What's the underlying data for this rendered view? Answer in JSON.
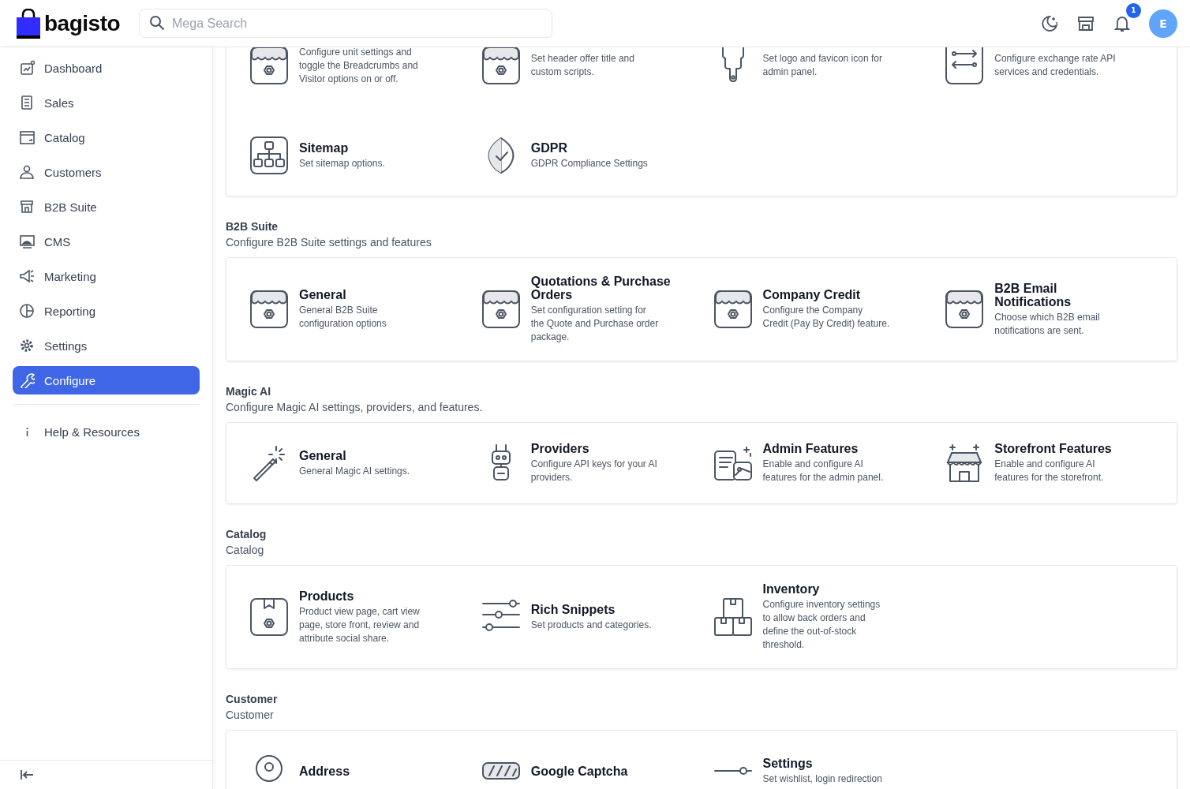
{
  "header": {
    "logo": "bagisto",
    "search": {
      "placeholder": "Mega Search"
    },
    "notification_count": "1",
    "avatar": "E"
  },
  "sidebar": {
    "items": [
      {
        "label": "Dashboard",
        "selected": false
      },
      {
        "label": "Sales",
        "selected": false
      },
      {
        "label": "Catalog",
        "selected": false
      },
      {
        "label": "Customers",
        "selected": false
      },
      {
        "label": "B2B Suite",
        "selected": false
      },
      {
        "label": "CMS",
        "selected": false
      },
      {
        "label": "Marketing",
        "selected": false
      },
      {
        "label": "Reporting",
        "selected": false
      },
      {
        "label": "Settings",
        "selected": false
      },
      {
        "label": "Configure",
        "selected": true
      }
    ],
    "help": "Help & Resources"
  },
  "sections": [
    {
      "items": [
        {
          "description": "Configure unit settings and toggle the Breadcrumbs and Visitor options on or off."
        },
        {
          "description": "Set header offer title and custom scripts."
        },
        {
          "description": "Set logo and favicon icon for admin panel."
        },
        {
          "description": "Configure exchange rate API services and credentials."
        },
        {
          "title": "Sitemap",
          "description": "Set sitemap options."
        },
        {
          "title": "GDPR",
          "description": "GDPR Compliance Settings"
        }
      ]
    },
    {
      "title": "B2B Suite",
      "subtitle": "Configure B2B Suite settings and features",
      "items": [
        {
          "title": "General",
          "description": "General B2B Suite configuration options"
        },
        {
          "title": "Quotations & Purchase Orders",
          "description": "Set configuration setting for the Quote and Purchase order package."
        },
        {
          "title": "Company Credit",
          "description": "Configure the Company Credit (Pay By Credit) feature."
        },
        {
          "title": "B2B Email Notifications",
          "description": "Choose which B2B email notifications are sent."
        }
      ]
    },
    {
      "title": "Magic AI",
      "subtitle": "Configure Magic AI settings, providers, and features.",
      "items": [
        {
          "title": "General",
          "description": "General Magic AI settings."
        },
        {
          "title": "Providers",
          "description": "Configure API keys for your AI providers."
        },
        {
          "title": "Admin Features",
          "description": "Enable and configure AI features for the admin panel."
        },
        {
          "title": "Storefront Features",
          "description": "Enable and configure AI features for the storefront."
        }
      ]
    },
    {
      "title": "Catalog",
      "subtitle": "Catalog",
      "items": [
        {
          "title": "Products",
          "description": "Product view page, cart view page, store front, review and attribute social share."
        },
        {
          "title": "Rich Snippets",
          "description": "Set products and categories."
        },
        {
          "title": "Inventory",
          "description": "Configure inventory settings to allow back orders and define the out-of-stock threshold."
        }
      ]
    },
    {
      "title": "Customer",
      "subtitle": "Customer",
      "items": [
        {
          "title": "Address"
        },
        {
          "title": "Google Captcha"
        },
        {
          "title": "Settings",
          "description": "Set wishlist, login redirection"
        }
      ]
    }
  ]
}
